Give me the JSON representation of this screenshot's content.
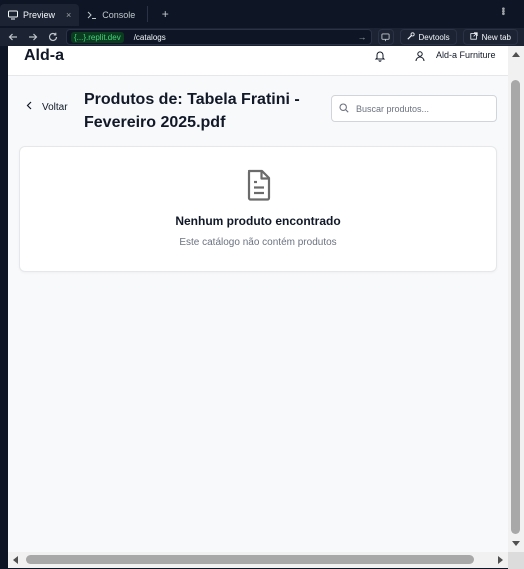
{
  "browser": {
    "tabs": [
      {
        "label": "Preview",
        "icon": "monitor-icon",
        "active": true
      },
      {
        "label": "Console",
        "icon": "terminal-icon",
        "active": false
      }
    ],
    "tab_close": "×",
    "new_tab_symbol": "+",
    "url_host": "{...}.replit.dev",
    "url_path": "/catalogs",
    "devtools_label": "Devtools",
    "newtab_label": "New tab"
  },
  "app": {
    "brand": "Ald-a",
    "company": "Ald-a Furniture",
    "back_label": "Voltar",
    "page_title": "Produtos de: Tabela Fratini - Fevereiro 2025.pdf",
    "search_placeholder": "Buscar produtos...",
    "empty_title": "Nenhum produto encontrado",
    "empty_subtitle": "Este catálogo não contém produtos"
  },
  "colors": {
    "chrome_bg": "#0e1525",
    "url_host_green": "#49d17d",
    "page_bg": "#f8f9fa",
    "text_dark": "#111827",
    "text_muted": "#6b7280"
  }
}
